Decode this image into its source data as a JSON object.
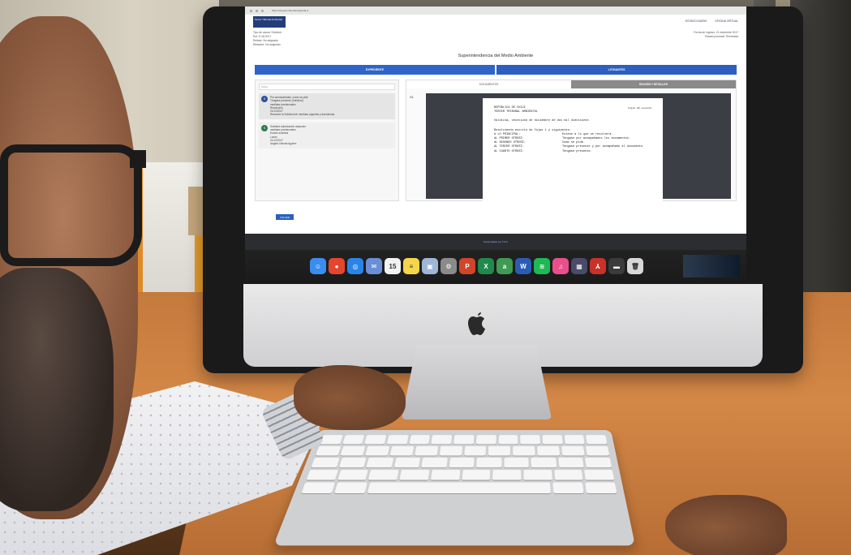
{
  "screen": {
    "url": "https://causas.tribunalambiental.cl",
    "top_links": [
      "ESTADO DIARIO",
      "OFICINA VIRTUAL"
    ],
    "meta_left": [
      "Tipo de causa: Solicitud",
      "Rol: S-18-2017",
      "Relator: No asignado",
      "Redactor: No asignado"
    ],
    "meta_right": [
      "Fecha de Ingreso: 21 diciembre 2017",
      "Estado procesal: Terminada"
    ],
    "page_title": "Superintendencia del Medio Ambiente",
    "tabs": [
      "EXPEDIENTE",
      "LITIGANTES"
    ],
    "filter_placeholder": "Todos",
    "entries": [
      {
        "badge": "S",
        "lines": [
          "Por acompañados, como se pide",
          "Téngase presente (Solicitud)",
          "medidas provisionales",
          "Resolución",
          "21/12/2017",
          "Resuelve la Solicitud de medidas urgentes y transitorias"
        ]
      },
      {
        "badge": "S",
        "lines": [
          "Solicitud autorización adopción",
          "medidas provisionales",
          "Escrito solicitud",
          "Lunes",
          "21/12/2017",
          "Angela Victoria Aguirre"
        ]
      }
    ],
    "doc_tabs": [
      "DOCUMENTOS",
      "EDICIÓN Y DETALLES"
    ],
    "doc_icon_label": "S1",
    "document": {
      "header": [
        "REPÚBLICA DE CHILE",
        "TERCER TRIBUNAL AMBIENTAL"
      ],
      "side_note": "Fojas 60 sesenta",
      "intro": "Valdivia, veintiuno de diciembre de dos mil diecisiete.",
      "lead": "Resolviendo escrito de fojas 1 y siguientes:",
      "rows": [
        {
          "label": "A LO PRINCIPAL:",
          "text": "Estese a lo que se resolverá."
        },
        {
          "label": "AL PRIMER OTROSÍ:",
          "text": "Téngase por acompañados los documentos."
        },
        {
          "label": "AL SEGUNDO OTROSÍ:",
          "text": "Como se pide."
        },
        {
          "label": "AL TERCER OTROSÍ:",
          "text": "Téngase presente y por acompañado el documento."
        },
        {
          "label": "AL CUARTO OTROSÍ:",
          "text": "Téngase presente."
        }
      ]
    },
    "back_button": "VOLVER",
    "footer": "Desarrollado por TIC's",
    "dock_icons": [
      {
        "name": "finder-icon",
        "color": "#3a8df0",
        "glyph": "☺"
      },
      {
        "name": "chrome-icon",
        "color": "#e5452f",
        "glyph": "●"
      },
      {
        "name": "safari-icon",
        "color": "#2a84e8",
        "glyph": "◎"
      },
      {
        "name": "mail-icon",
        "color": "#6a8fd6",
        "glyph": "✉"
      },
      {
        "name": "calendar-icon",
        "color": "#f2f2f2",
        "glyph": "15"
      },
      {
        "name": "notes-icon",
        "color": "#f5d64b",
        "glyph": "≡"
      },
      {
        "name": "preview-icon",
        "color": "#9fb6d6",
        "glyph": "▣"
      },
      {
        "name": "system-preferences-icon",
        "color": "#8a8a8a",
        "glyph": "⚙"
      },
      {
        "name": "powerpoint-icon",
        "color": "#d1452a",
        "glyph": "P"
      },
      {
        "name": "excel-icon",
        "color": "#1f8a4c",
        "glyph": "X"
      },
      {
        "name": "archive-icon",
        "color": "#3f9a52",
        "glyph": "a"
      },
      {
        "name": "word-icon",
        "color": "#2b5cb5",
        "glyph": "W"
      },
      {
        "name": "spotify-icon",
        "color": "#1db954",
        "glyph": "≋"
      },
      {
        "name": "itunes-icon",
        "color": "#e94f8a",
        "glyph": "♫"
      },
      {
        "name": "photo-booth-icon",
        "color": "#4a4a6a",
        "glyph": "▦"
      },
      {
        "name": "acrobat-icon",
        "color": "#c83228",
        "glyph": "⅄"
      },
      {
        "name": "folder-icon",
        "color": "#3b3b3b",
        "glyph": "▬"
      },
      {
        "name": "trash-icon",
        "color": "#d8d8d8",
        "glyph": "🗑"
      }
    ],
    "background_sign": "GL"
  }
}
